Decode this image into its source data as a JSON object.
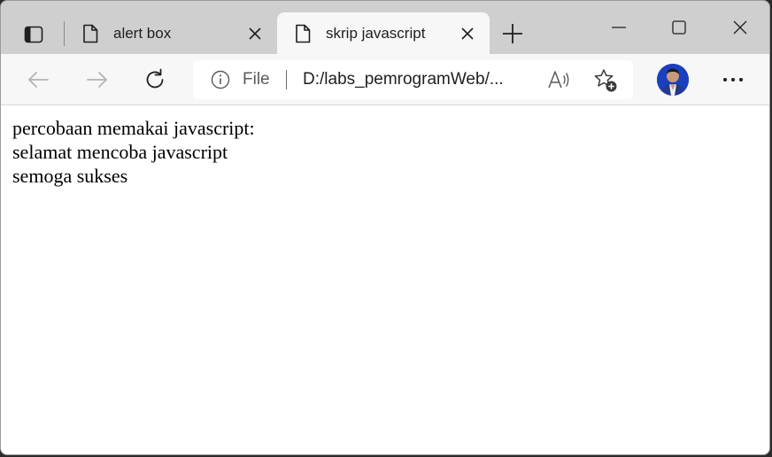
{
  "tabs": [
    {
      "label": "alert box",
      "active": false
    },
    {
      "label": "skrip javascript",
      "active": true
    }
  ],
  "address": {
    "scheme": "File",
    "url": "D:/labs_pemrogramWeb/..."
  },
  "page": {
    "lines": [
      "percobaan memakai javascript:",
      "selamat mencoba javascript",
      "semoga sukses"
    ]
  },
  "icons": {
    "tab_actions": "tab-actions-icon",
    "page": "page-icon",
    "close": "close-icon",
    "new_tab": "plus-icon",
    "minimize": "minimize-icon",
    "maximize": "maximize-icon",
    "window_close": "close-icon",
    "back": "arrow-left-icon",
    "forward": "arrow-right-icon",
    "refresh": "refresh-icon",
    "info": "info-icon",
    "read_aloud": "read-aloud-icon",
    "favorites": "add-favorite-icon",
    "profile": "avatar",
    "more": "more-icon"
  },
  "colors": {
    "titlebar": "#cfcfcf",
    "toolbar": "#f7f7f7",
    "avatar": "#1a3fbf"
  }
}
